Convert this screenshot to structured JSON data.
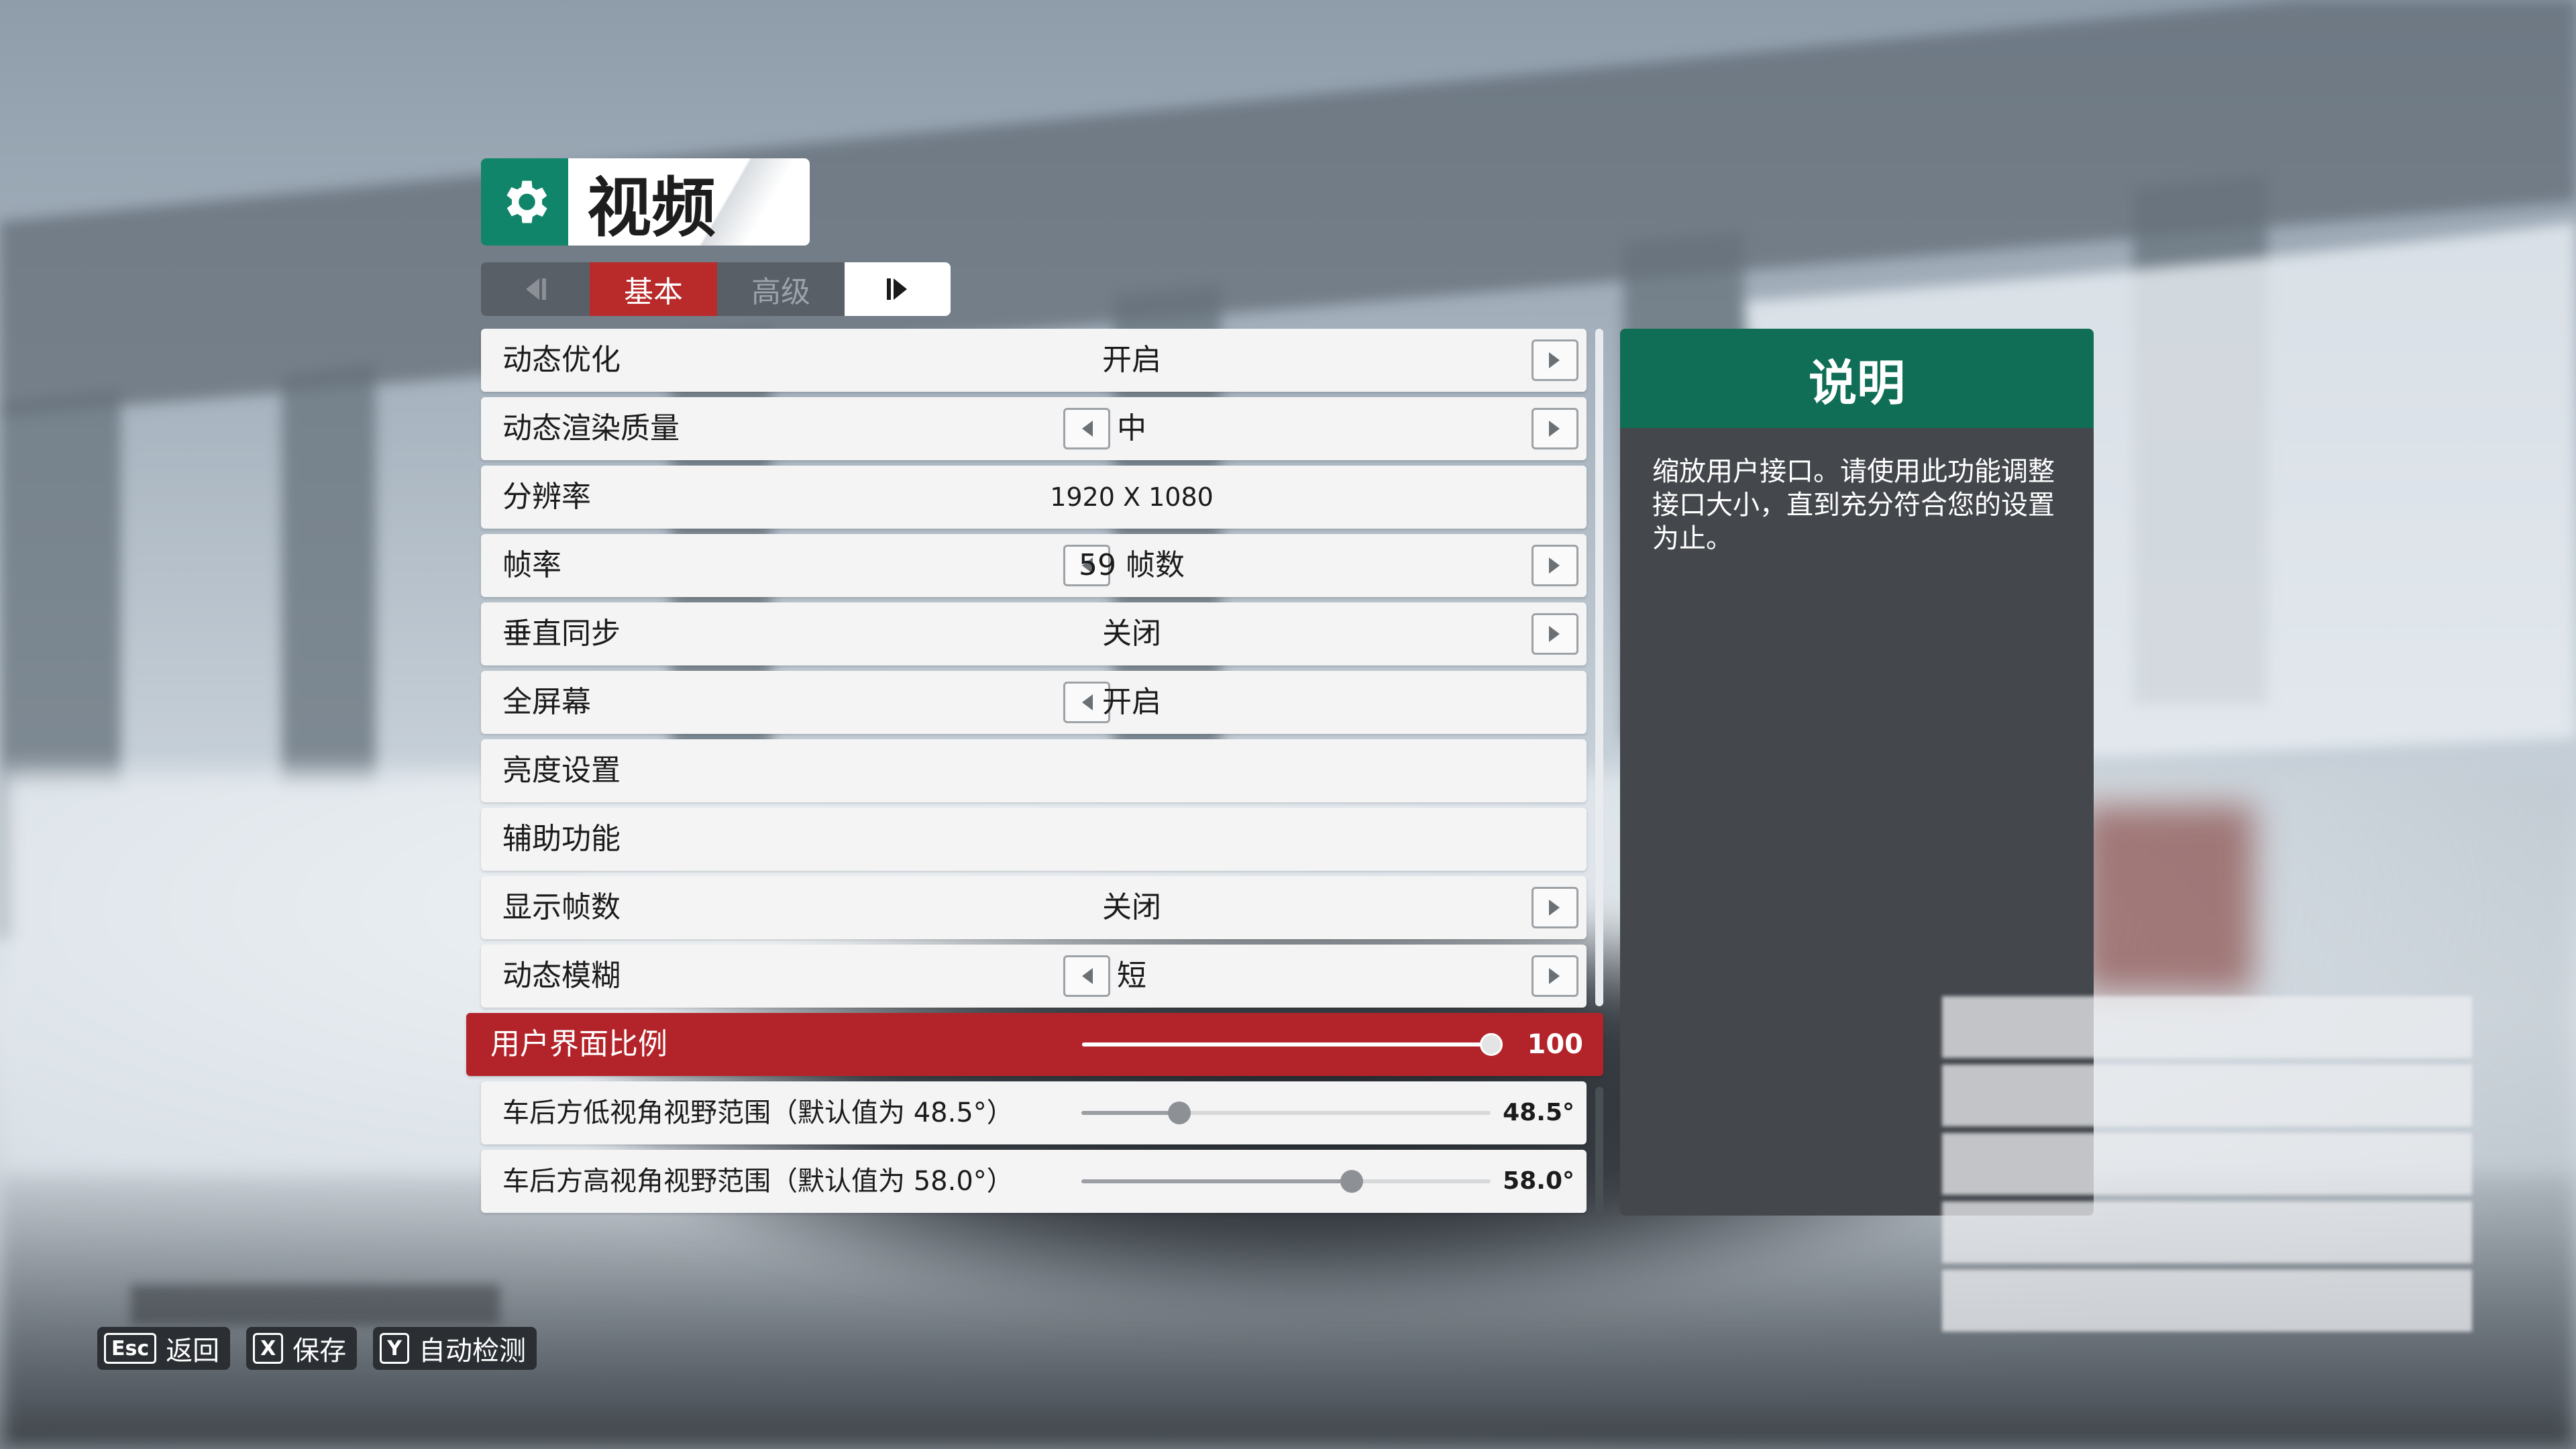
{
  "screen": {
    "title": "视频",
    "title_icon": "gear-icon",
    "accent_color": "#b92a2a",
    "brand_color": "#11856a"
  },
  "tabs": {
    "prev_icon": "tab-prev-icon",
    "basic": "基本",
    "advanced": "高级",
    "next_icon": "tab-next-icon",
    "active": "基本"
  },
  "settings": [
    {
      "label": "动态优化",
      "value": "开启"
    },
    {
      "label": "动态渲染质量",
      "value": "中"
    },
    {
      "label": "分辨率",
      "value": "1920 X 1080"
    },
    {
      "label": "帧率",
      "value": "59 帧数"
    },
    {
      "label": "垂直同步",
      "value": "关闭"
    },
    {
      "label": "全屏幕",
      "value": "开启"
    },
    {
      "label": "亮度设置",
      "value": ""
    },
    {
      "label": "辅助功能",
      "value": ""
    },
    {
      "label": "显示帧数",
      "value": "关闭"
    },
    {
      "label": "动态模糊",
      "value": "短"
    }
  ],
  "sliders": {
    "ui_scale": {
      "label": "用户界面比例",
      "value": "100",
      "fraction": 1.0
    },
    "rear_low_fov": {
      "label": "车后方低视角视野范围（默认值为 48.5°）",
      "value": "48.5°",
      "fraction": 0.24
    },
    "rear_high_fov": {
      "label": "车后方高视角视野范围（默认值为 58.0°）",
      "value": "58.0°",
      "fraction": 0.66
    }
  },
  "description": {
    "heading": "说明",
    "text": "缩放用户接口。请使用此功能调整接口大小，直到充分符合您的设置为止。"
  },
  "bottom_hints": [
    {
      "key": "Esc",
      "label": "返回"
    },
    {
      "key": "X",
      "label": "保存"
    },
    {
      "key": "Y",
      "label": "自动检测"
    }
  ]
}
